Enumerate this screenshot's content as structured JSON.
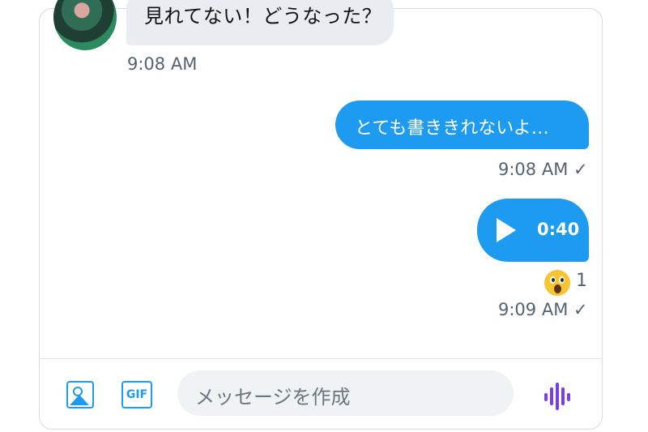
{
  "messages": {
    "incoming": {
      "text": "見れてない！どうなった？",
      "time": "9:08 AM"
    },
    "outgoing_text": {
      "text": "とても書ききれないよ…",
      "time": "9:08 AM ✓"
    },
    "outgoing_voice": {
      "duration": "0:40",
      "time": "9:09 AM ✓",
      "reaction_count": "1"
    }
  },
  "composer": {
    "placeholder": "メッセージを作成",
    "gif_label": "GIF"
  },
  "colors": {
    "accent": "#1d9bf0",
    "bubble_in": "#e9edf1",
    "voice": "#7b3fe4"
  }
}
